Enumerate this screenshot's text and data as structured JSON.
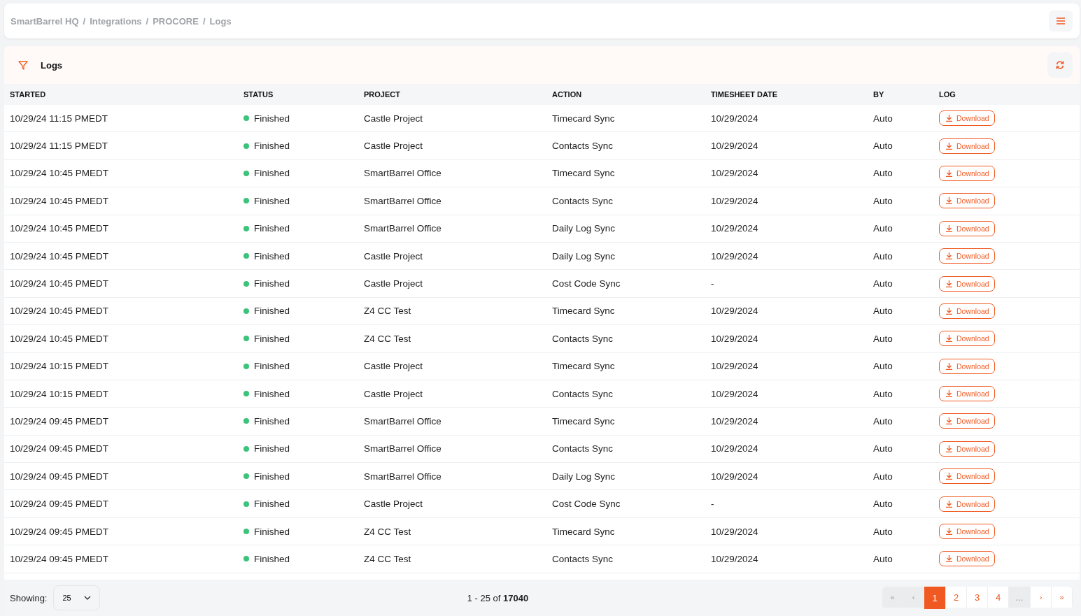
{
  "breadcrumb": [
    {
      "label": "SmartBarrel HQ"
    },
    {
      "separator": "/",
      "label": "Integrations"
    },
    {
      "separator": "/",
      "label": "PROCORE"
    },
    {
      "separator": "/",
      "label": "Logs"
    }
  ],
  "panel": {
    "title": "Logs"
  },
  "table": {
    "columns": [
      "STARTED",
      "STATUS",
      "PROJECT",
      "ACTION",
      "TIMESHEET DATE",
      "BY",
      "LOG"
    ],
    "rows": [
      {
        "started": "10/29/24 11:15 PMEDT",
        "status": "Finished",
        "color": "#3cc37a",
        "project": "Castle Project",
        "action": "Timecard Sync",
        "date": "10/29/2024",
        "by": "Auto",
        "log": "Download"
      },
      {
        "started": "10/29/24 11:15 PMEDT",
        "status": "Finished",
        "color": "#3cc37a",
        "project": "Castle Project",
        "action": "Contacts Sync",
        "date": "10/29/2024",
        "by": "Auto",
        "log": "Download"
      },
      {
        "started": "10/29/24 10:45 PMEDT",
        "status": "Finished",
        "color": "#3cc37a",
        "project": "SmartBarrel Office",
        "action": "Timecard Sync",
        "date": "10/29/2024",
        "by": "Auto",
        "log": "Download"
      },
      {
        "started": "10/29/24 10:45 PMEDT",
        "status": "Finished",
        "color": "#3cc37a",
        "project": "SmartBarrel Office",
        "action": "Contacts Sync",
        "date": "10/29/2024",
        "by": "Auto",
        "log": "Download"
      },
      {
        "started": "10/29/24 10:45 PMEDT",
        "status": "Finished",
        "color": "#3cc37a",
        "project": "SmartBarrel Office",
        "action": "Daily Log Sync",
        "date": "10/29/2024",
        "by": "Auto",
        "log": "Download"
      },
      {
        "started": "10/29/24 10:45 PMEDT",
        "status": "Finished",
        "color": "#3cc37a",
        "project": "Castle Project",
        "action": "Daily Log Sync",
        "date": "10/29/2024",
        "by": "Auto",
        "log": "Download"
      },
      {
        "started": "10/29/24 10:45 PMEDT",
        "status": "Finished",
        "color": "#3cc37a",
        "project": "Castle Project",
        "action": "Cost Code Sync",
        "date": "-",
        "by": "Auto",
        "log": "Download"
      },
      {
        "started": "10/29/24 10:45 PMEDT",
        "status": "Finished",
        "color": "#3cc37a",
        "project": "Z4 CC Test",
        "action": "Timecard Sync",
        "date": "10/29/2024",
        "by": "Auto",
        "log": "Download"
      },
      {
        "started": "10/29/24 10:45 PMEDT",
        "status": "Finished",
        "color": "#3cc37a",
        "project": "Z4 CC Test",
        "action": "Contacts Sync",
        "date": "10/29/2024",
        "by": "Auto",
        "log": "Download"
      },
      {
        "started": "10/29/24 10:15 PMEDT",
        "status": "Finished",
        "color": "#3cc37a",
        "project": "Castle Project",
        "action": "Timecard Sync",
        "date": "10/29/2024",
        "by": "Auto",
        "log": "Download"
      },
      {
        "started": "10/29/24 10:15 PMEDT",
        "status": "Finished",
        "color": "#3cc37a",
        "project": "Castle Project",
        "action": "Contacts Sync",
        "date": "10/29/2024",
        "by": "Auto",
        "log": "Download"
      },
      {
        "started": "10/29/24 09:45 PMEDT",
        "status": "Finished",
        "color": "#3cc37a",
        "project": "SmartBarrel Office",
        "action": "Timecard Sync",
        "date": "10/29/2024",
        "by": "Auto",
        "log": "Download"
      },
      {
        "started": "10/29/24 09:45 PMEDT",
        "status": "Finished",
        "color": "#3cc37a",
        "project": "SmartBarrel Office",
        "action": "Contacts Sync",
        "date": "10/29/2024",
        "by": "Auto",
        "log": "Download"
      },
      {
        "started": "10/29/24 09:45 PMEDT",
        "status": "Finished",
        "color": "#3cc37a",
        "project": "SmartBarrel Office",
        "action": "Daily Log Sync",
        "date": "10/29/2024",
        "by": "Auto",
        "log": "Download"
      },
      {
        "started": "10/29/24 09:45 PMEDT",
        "status": "Finished",
        "color": "#3cc37a",
        "project": "Castle Project",
        "action": "Cost Code Sync",
        "date": "-",
        "by": "Auto",
        "log": "Download"
      },
      {
        "started": "10/29/24 09:45 PMEDT",
        "status": "Finished",
        "color": "#3cc37a",
        "project": "Z4 CC Test",
        "action": "Timecard Sync",
        "date": "10/29/2024",
        "by": "Auto",
        "log": "Download"
      },
      {
        "started": "10/29/24 09:45 PMEDT",
        "status": "Finished",
        "color": "#3cc37a",
        "project": "Z4 CC Test",
        "action": "Contacts Sync",
        "date": "10/29/2024",
        "by": "Auto",
        "log": "Download"
      }
    ]
  },
  "footer": {
    "showing_label": "Showing:",
    "page_size": "25",
    "range": "1 - 25 of **17040**",
    "pagination": [
      {
        "label": "«",
        "kind": "nav",
        "disabled": true,
        "selected": false
      },
      {
        "label": "‹",
        "kind": "nav",
        "disabled": true,
        "selected": false
      },
      {
        "label": "1",
        "kind": "page",
        "disabled": false,
        "selected": true
      },
      {
        "label": "2",
        "kind": "page",
        "disabled": false,
        "selected": false
      },
      {
        "label": "3",
        "kind": "page",
        "disabled": false,
        "selected": false
      },
      {
        "label": "4",
        "kind": "page",
        "disabled": false,
        "selected": false
      },
      {
        "label": "...",
        "kind": "ellipsis",
        "disabled": true,
        "selected": false
      },
      {
        "label": "›",
        "kind": "nav",
        "disabled": false,
        "selected": false
      },
      {
        "label": "»",
        "kind": "nav",
        "disabled": false,
        "selected": false
      }
    ]
  }
}
